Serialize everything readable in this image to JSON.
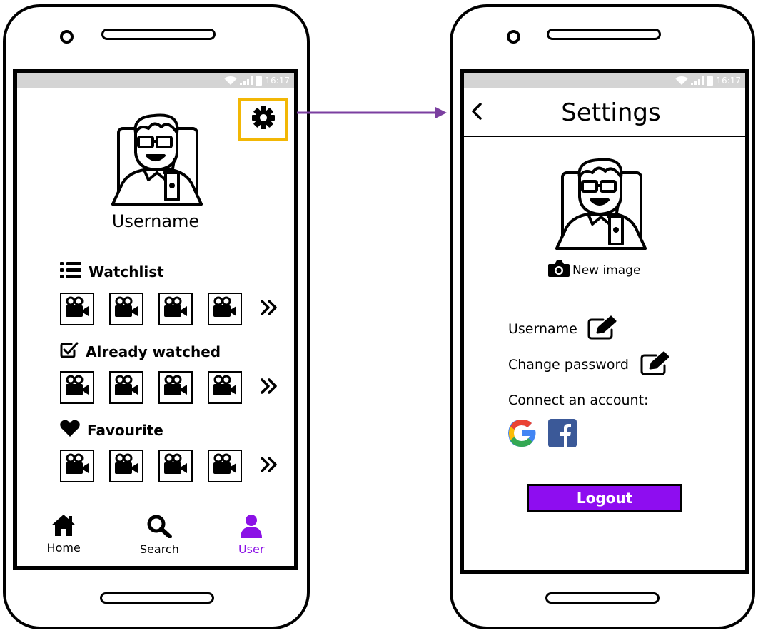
{
  "status": {
    "time": "16:17"
  },
  "profile": {
    "username": "Username",
    "sections": [
      {
        "label": "Watchlist",
        "icon": "list-icon"
      },
      {
        "label": "Already watched",
        "icon": "checkbox-icon"
      },
      {
        "label": "Favourite",
        "icon": "heart-icon"
      }
    ],
    "more_icon": "double-chevron-right-icon",
    "nav": [
      {
        "label": "Home",
        "icon": "home-icon",
        "active": false
      },
      {
        "label": "Search",
        "icon": "search-icon",
        "active": false
      },
      {
        "label": "User",
        "icon": "user-icon",
        "active": true
      }
    ],
    "settings_icon": "gear-icon"
  },
  "settings": {
    "title": "Settings",
    "back_icon": "chevron-left-icon",
    "new_image_label": "New image",
    "username_label": "Username",
    "change_password_label": "Change password",
    "connect_label": "Connect an account:",
    "providers": [
      "google",
      "facebook"
    ],
    "logout_label": "Logout"
  },
  "colors": {
    "accent": "#8e0df0",
    "highlight": "#f2b705",
    "arrow": "#7b3fa0",
    "statusbar": "#d4d4d4"
  }
}
